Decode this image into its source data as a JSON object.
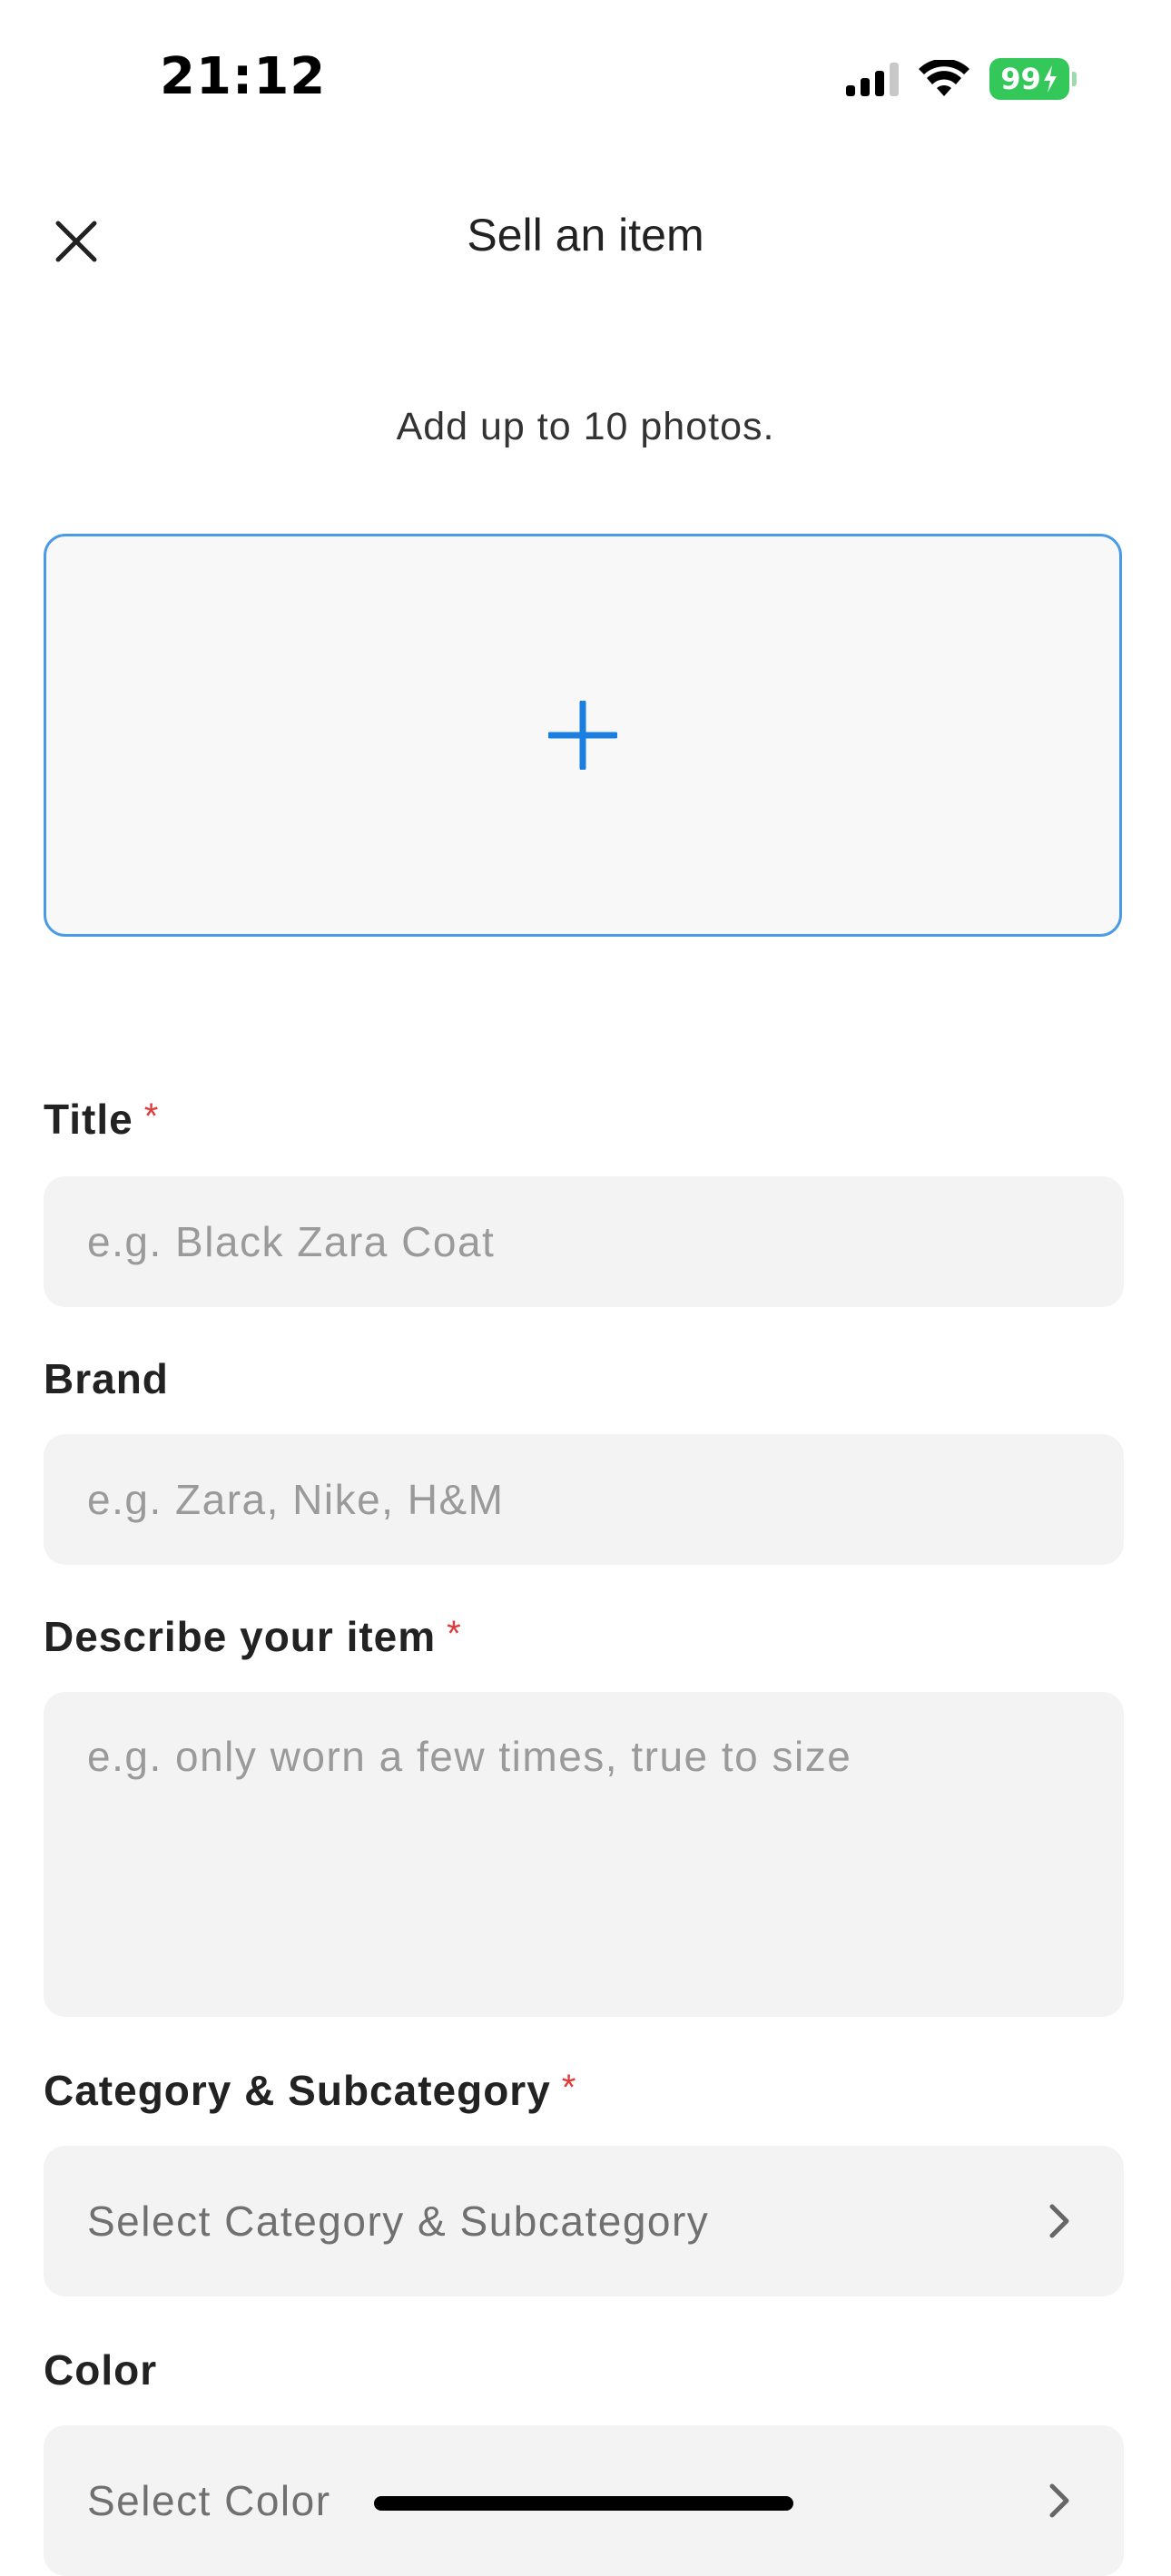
{
  "status_bar": {
    "time": "21:12",
    "battery": "99",
    "icons": [
      "cellular-signal-icon",
      "wifi-icon",
      "battery-charging-icon"
    ]
  },
  "header": {
    "title": "Sell an item",
    "close_icon": "close-icon"
  },
  "photos": {
    "hint": "Add up to 10 photos.",
    "add_icon": "plus-icon",
    "accent_color": "#1a7fe0"
  },
  "form": {
    "title": {
      "label": "Title",
      "required_mark": "*",
      "placeholder": "e.g. Black Zara Coat"
    },
    "brand": {
      "label": "Brand",
      "placeholder": "e.g. Zara, Nike, H&M"
    },
    "description": {
      "label": "Describe your item",
      "required_mark": "*",
      "placeholder": "e.g. only worn a few times, true to size"
    },
    "category": {
      "label": "Category & Subcategory",
      "required_mark": "*",
      "value": "Select Category & Subcategory"
    },
    "color": {
      "label": "Color",
      "value": "Select Color"
    }
  },
  "colors": {
    "required": "#e03a3a",
    "photo_border": "#4a9be6",
    "battery": "#34c759"
  }
}
